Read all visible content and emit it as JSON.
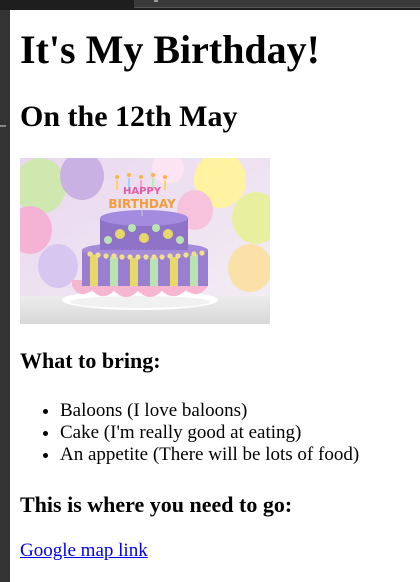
{
  "page": {
    "title": "It's My Birthday!",
    "subtitle": "On the 12th May",
    "image": {
      "alt": "Birthday cake",
      "topper_text": "HAPPY BIRTHDAY"
    },
    "bring_heading": "What to bring:",
    "bring_items": [
      "Baloons (I love baloons)",
      "Cake (I'm really good at eating)",
      "An appetite (There will be lots of food)"
    ],
    "go_heading": "This is where you need to go:",
    "map_link": {
      "label": "Google map link"
    }
  },
  "colors": {
    "link": "#0000ee",
    "background": "#ffffff",
    "frame": "#2a2a2a"
  }
}
